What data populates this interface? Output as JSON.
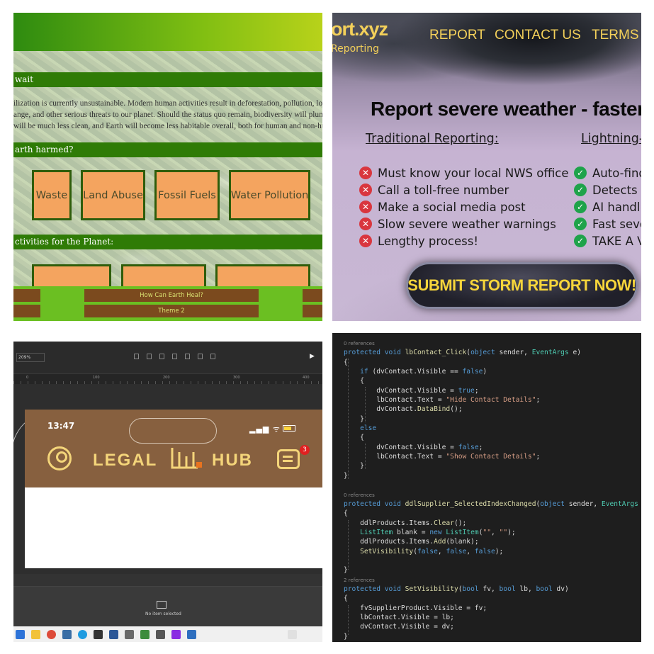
{
  "panel1": {
    "section_wait": "wait",
    "paragraph_lines": [
      "ilization is currently unsustainable. Modern human activities result in deforestation, pollution, loss",
      "ange, and other serious threats to our planet. Should the status quo remain, biodiversity will plumm",
      "will be much less clean, and Earth will become less habitable overall, both for human and non-huma"
    ],
    "section_harmed": "arth harmed?",
    "harm_boxes": [
      "Waste",
      "Land Abuse",
      "Fossil Fuels",
      "Water Pollution"
    ],
    "section_activities": "ctivities for the Planet:",
    "nav_buttons": [
      "How Can Earth Heal?",
      "Theme 2"
    ],
    "colors": {
      "bar": "#2f7b06",
      "box": "#f4a45f",
      "button": "#7b4a1e"
    }
  },
  "panel2": {
    "logo": "ort.xyz",
    "logo_sub": "Reporting",
    "nav": [
      "REPORT",
      "CONTACT US",
      "TERMS"
    ],
    "headline": "Report severe weather - faster",
    "traditional_heading": "Traditional Reporting:",
    "lightning_heading": "Lightning-R",
    "traditional_items": [
      "Must know your local NWS office",
      "Call a toll-free number",
      "Make a social media post",
      "Slow severe weather warnings",
      "Lengthy process!"
    ],
    "lightning_items": [
      "Auto-find",
      "Detects y",
      "AI handl",
      "Fast seve",
      "TAKE A V"
    ],
    "cta": "SUBMIT STORM REPORT NOW!",
    "colors": {
      "accent": "#f3d05a",
      "cta_text": "#f6d53b",
      "bad": "#d9363e",
      "good": "#1ea34a"
    }
  },
  "panel3": {
    "zoom": "209%",
    "ruler_ticks": [
      "0",
      "100",
      "200",
      "300",
      "400"
    ],
    "time": "13:47",
    "brand_left": "LEGAL",
    "brand_right": "HUB",
    "notification_count": "3",
    "no_item": "No item selected",
    "colors": {
      "header": "#87603f",
      "brand": "#f4d57a",
      "badge": "#e02020"
    }
  },
  "panel4": {
    "lines": [
      {
        "t": "ref",
        "text": "0 references"
      },
      {
        "t": "code",
        "html": "<span class=\"kw\">protected</span> <span class=\"kw\">void</span> <span class=\"fn\">lbContact_Click</span>(<span class=\"kw\">object</span> sender, <span class=\"ty\">EventArgs</span> e)"
      },
      {
        "t": "code",
        "html": "{"
      },
      {
        "t": "code",
        "html": "    <span class=\"kw\">if</span> (dvContact.Visible == <span class=\"kw\">false</span>)"
      },
      {
        "t": "code",
        "html": "    {"
      },
      {
        "t": "code",
        "html": "        dvContact.Visible = <span class=\"kw\">true</span>;"
      },
      {
        "t": "code",
        "html": "        lbContact.Text = <span class=\"st\">\"Hide Contact Details\"</span>;"
      },
      {
        "t": "code",
        "html": "        dvContact.<span class=\"fn\">DataBind</span>();"
      },
      {
        "t": "code",
        "html": "    }"
      },
      {
        "t": "code",
        "html": "    <span class=\"kw\">else</span>"
      },
      {
        "t": "code",
        "html": "    {"
      },
      {
        "t": "code",
        "html": "        dvContact.Visible = <span class=\"kw\">false</span>;"
      },
      {
        "t": "code",
        "html": "        lbContact.Text = <span class=\"st\">\"Show Contact Details\"</span>;"
      },
      {
        "t": "code",
        "html": "    }"
      },
      {
        "t": "code",
        "html": "}"
      },
      {
        "t": "code",
        "html": ""
      },
      {
        "t": "ref",
        "text": "0 references"
      },
      {
        "t": "code",
        "html": "<span class=\"kw\">protected</span> <span class=\"kw\">void</span> <span class=\"fn\">ddlSupplier_SelectedIndexChanged</span>(<span class=\"kw\">object</span> sender, <span class=\"ty\">EventArgs</span> e"
      },
      {
        "t": "code",
        "html": "{"
      },
      {
        "t": "code",
        "html": "    ddlProducts.Items.<span class=\"fn\">Clear</span>();"
      },
      {
        "t": "code",
        "html": "    <span class=\"ty\">ListItem</span> blank = <span class=\"kw\">new</span> <span class=\"ty\">ListItem</span>(<span class=\"st\">\"\"</span>, <span class=\"st\">\"\"</span>);"
      },
      {
        "t": "code",
        "html": "    ddlProducts.Items.<span class=\"fn\">Add</span>(blank);"
      },
      {
        "t": "code",
        "html": "    <span class=\"fn\">SetVisibility</span>(<span class=\"kw\">false</span>, <span class=\"kw\">false</span>, <span class=\"kw\">false</span>);"
      },
      {
        "t": "code",
        "html": ""
      },
      {
        "t": "code",
        "html": "}"
      },
      {
        "t": "ref",
        "text": "2 references"
      },
      {
        "t": "code",
        "html": "<span class=\"kw\">protected</span> <span class=\"kw\">void</span> <span class=\"fn\">SetVisibility</span>(<span class=\"kw\">bool</span> fv, <span class=\"kw\">bool</span> lb, <span class=\"kw\">bool</span> dv)"
      },
      {
        "t": "code",
        "html": "{"
      },
      {
        "t": "code",
        "html": "    fvSupplierProduct.Visible = fv;"
      },
      {
        "t": "code",
        "html": "    lbContact.Visible = lb;"
      },
      {
        "t": "code",
        "html": "    dvContact.Visible = dv;"
      },
      {
        "t": "code",
        "html": "}"
      }
    ]
  }
}
